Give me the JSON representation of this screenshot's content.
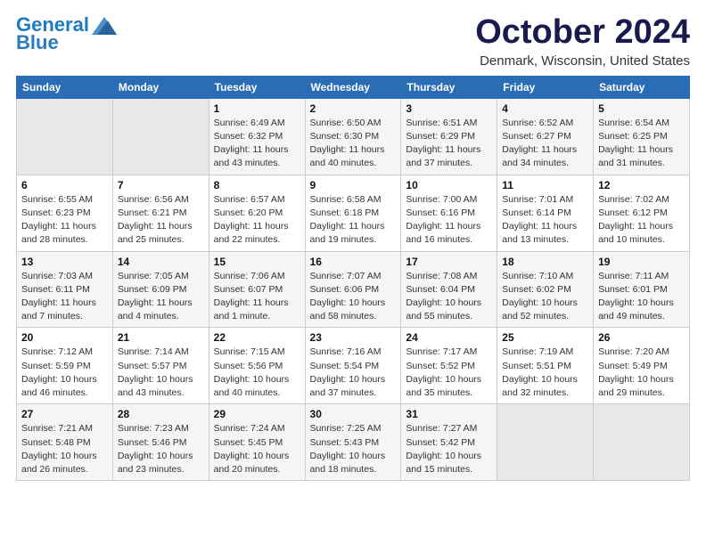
{
  "header": {
    "logo_line1": "General",
    "logo_line2": "Blue",
    "month": "October 2024",
    "location": "Denmark, Wisconsin, United States"
  },
  "days_of_week": [
    "Sunday",
    "Monday",
    "Tuesday",
    "Wednesday",
    "Thursday",
    "Friday",
    "Saturday"
  ],
  "weeks": [
    [
      {
        "day": "",
        "sunrise": "",
        "sunset": "",
        "daylight": ""
      },
      {
        "day": "",
        "sunrise": "",
        "sunset": "",
        "daylight": ""
      },
      {
        "day": "1",
        "sunrise": "Sunrise: 6:49 AM",
        "sunset": "Sunset: 6:32 PM",
        "daylight": "Daylight: 11 hours and 43 minutes."
      },
      {
        "day": "2",
        "sunrise": "Sunrise: 6:50 AM",
        "sunset": "Sunset: 6:30 PM",
        "daylight": "Daylight: 11 hours and 40 minutes."
      },
      {
        "day": "3",
        "sunrise": "Sunrise: 6:51 AM",
        "sunset": "Sunset: 6:29 PM",
        "daylight": "Daylight: 11 hours and 37 minutes."
      },
      {
        "day": "4",
        "sunrise": "Sunrise: 6:52 AM",
        "sunset": "Sunset: 6:27 PM",
        "daylight": "Daylight: 11 hours and 34 minutes."
      },
      {
        "day": "5",
        "sunrise": "Sunrise: 6:54 AM",
        "sunset": "Sunset: 6:25 PM",
        "daylight": "Daylight: 11 hours and 31 minutes."
      }
    ],
    [
      {
        "day": "6",
        "sunrise": "Sunrise: 6:55 AM",
        "sunset": "Sunset: 6:23 PM",
        "daylight": "Daylight: 11 hours and 28 minutes."
      },
      {
        "day": "7",
        "sunrise": "Sunrise: 6:56 AM",
        "sunset": "Sunset: 6:21 PM",
        "daylight": "Daylight: 11 hours and 25 minutes."
      },
      {
        "day": "8",
        "sunrise": "Sunrise: 6:57 AM",
        "sunset": "Sunset: 6:20 PM",
        "daylight": "Daylight: 11 hours and 22 minutes."
      },
      {
        "day": "9",
        "sunrise": "Sunrise: 6:58 AM",
        "sunset": "Sunset: 6:18 PM",
        "daylight": "Daylight: 11 hours and 19 minutes."
      },
      {
        "day": "10",
        "sunrise": "Sunrise: 7:00 AM",
        "sunset": "Sunset: 6:16 PM",
        "daylight": "Daylight: 11 hours and 16 minutes."
      },
      {
        "day": "11",
        "sunrise": "Sunrise: 7:01 AM",
        "sunset": "Sunset: 6:14 PM",
        "daylight": "Daylight: 11 hours and 13 minutes."
      },
      {
        "day": "12",
        "sunrise": "Sunrise: 7:02 AM",
        "sunset": "Sunset: 6:12 PM",
        "daylight": "Daylight: 11 hours and 10 minutes."
      }
    ],
    [
      {
        "day": "13",
        "sunrise": "Sunrise: 7:03 AM",
        "sunset": "Sunset: 6:11 PM",
        "daylight": "Daylight: 11 hours and 7 minutes."
      },
      {
        "day": "14",
        "sunrise": "Sunrise: 7:05 AM",
        "sunset": "Sunset: 6:09 PM",
        "daylight": "Daylight: 11 hours and 4 minutes."
      },
      {
        "day": "15",
        "sunrise": "Sunrise: 7:06 AM",
        "sunset": "Sunset: 6:07 PM",
        "daylight": "Daylight: 11 hours and 1 minute."
      },
      {
        "day": "16",
        "sunrise": "Sunrise: 7:07 AM",
        "sunset": "Sunset: 6:06 PM",
        "daylight": "Daylight: 10 hours and 58 minutes."
      },
      {
        "day": "17",
        "sunrise": "Sunrise: 7:08 AM",
        "sunset": "Sunset: 6:04 PM",
        "daylight": "Daylight: 10 hours and 55 minutes."
      },
      {
        "day": "18",
        "sunrise": "Sunrise: 7:10 AM",
        "sunset": "Sunset: 6:02 PM",
        "daylight": "Daylight: 10 hours and 52 minutes."
      },
      {
        "day": "19",
        "sunrise": "Sunrise: 7:11 AM",
        "sunset": "Sunset: 6:01 PM",
        "daylight": "Daylight: 10 hours and 49 minutes."
      }
    ],
    [
      {
        "day": "20",
        "sunrise": "Sunrise: 7:12 AM",
        "sunset": "Sunset: 5:59 PM",
        "daylight": "Daylight: 10 hours and 46 minutes."
      },
      {
        "day": "21",
        "sunrise": "Sunrise: 7:14 AM",
        "sunset": "Sunset: 5:57 PM",
        "daylight": "Daylight: 10 hours and 43 minutes."
      },
      {
        "day": "22",
        "sunrise": "Sunrise: 7:15 AM",
        "sunset": "Sunset: 5:56 PM",
        "daylight": "Daylight: 10 hours and 40 minutes."
      },
      {
        "day": "23",
        "sunrise": "Sunrise: 7:16 AM",
        "sunset": "Sunset: 5:54 PM",
        "daylight": "Daylight: 10 hours and 37 minutes."
      },
      {
        "day": "24",
        "sunrise": "Sunrise: 7:17 AM",
        "sunset": "Sunset: 5:52 PM",
        "daylight": "Daylight: 10 hours and 35 minutes."
      },
      {
        "day": "25",
        "sunrise": "Sunrise: 7:19 AM",
        "sunset": "Sunset: 5:51 PM",
        "daylight": "Daylight: 10 hours and 32 minutes."
      },
      {
        "day": "26",
        "sunrise": "Sunrise: 7:20 AM",
        "sunset": "Sunset: 5:49 PM",
        "daylight": "Daylight: 10 hours and 29 minutes."
      }
    ],
    [
      {
        "day": "27",
        "sunrise": "Sunrise: 7:21 AM",
        "sunset": "Sunset: 5:48 PM",
        "daylight": "Daylight: 10 hours and 26 minutes."
      },
      {
        "day": "28",
        "sunrise": "Sunrise: 7:23 AM",
        "sunset": "Sunset: 5:46 PM",
        "daylight": "Daylight: 10 hours and 23 minutes."
      },
      {
        "day": "29",
        "sunrise": "Sunrise: 7:24 AM",
        "sunset": "Sunset: 5:45 PM",
        "daylight": "Daylight: 10 hours and 20 minutes."
      },
      {
        "day": "30",
        "sunrise": "Sunrise: 7:25 AM",
        "sunset": "Sunset: 5:43 PM",
        "daylight": "Daylight: 10 hours and 18 minutes."
      },
      {
        "day": "31",
        "sunrise": "Sunrise: 7:27 AM",
        "sunset": "Sunset: 5:42 PM",
        "daylight": "Daylight: 10 hours and 15 minutes."
      },
      {
        "day": "",
        "sunrise": "",
        "sunset": "",
        "daylight": ""
      },
      {
        "day": "",
        "sunrise": "",
        "sunset": "",
        "daylight": ""
      }
    ]
  ]
}
